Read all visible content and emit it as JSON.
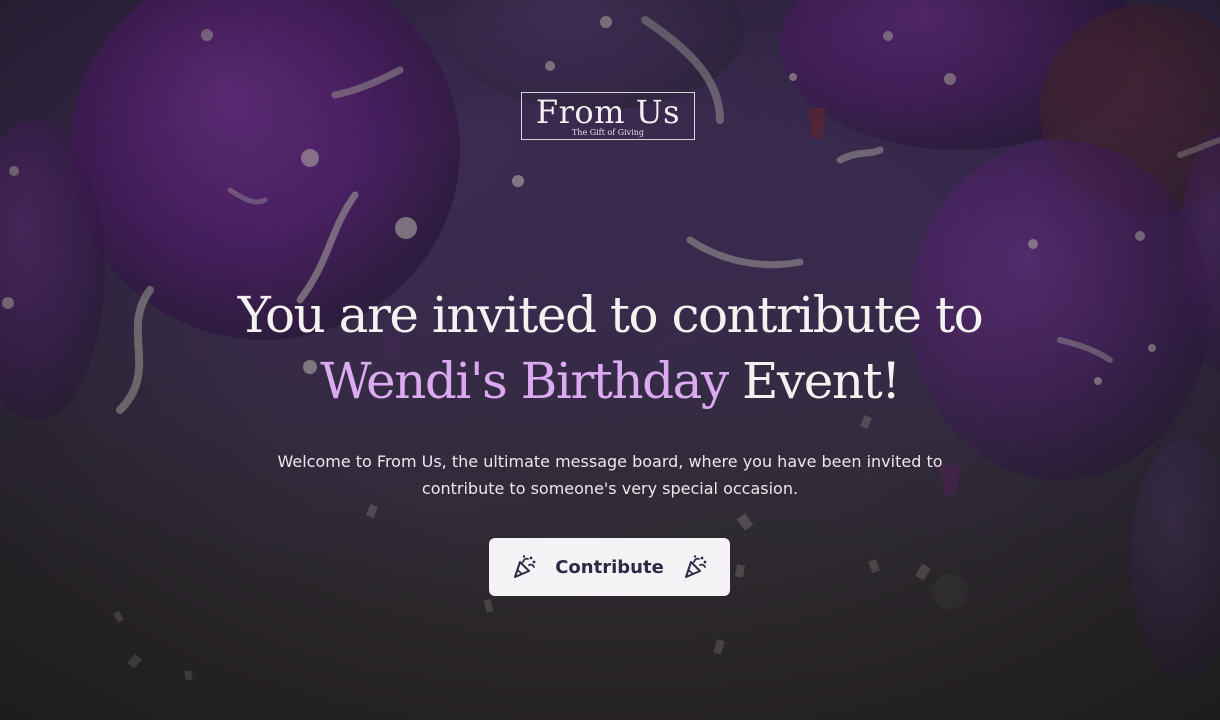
{
  "logo": {
    "title": "From Us",
    "tagline": "The Gift of Giving"
  },
  "hero": {
    "line1": "You are invited to contribute to",
    "event_name": "Wendi's Birthday",
    "event_suffix": " Event!",
    "description": "Welcome to From Us, the ultimate message board, where you have been invited to contribute to someone's very special occasion."
  },
  "cta": {
    "label": "Contribute",
    "icon": "party-popper-icon"
  },
  "colors": {
    "highlight": "#dcaaf0",
    "heading": "#f4f1f1",
    "button_bg": "#f5f3f5",
    "button_text": "#2c2a45",
    "background": "#302a3e"
  }
}
